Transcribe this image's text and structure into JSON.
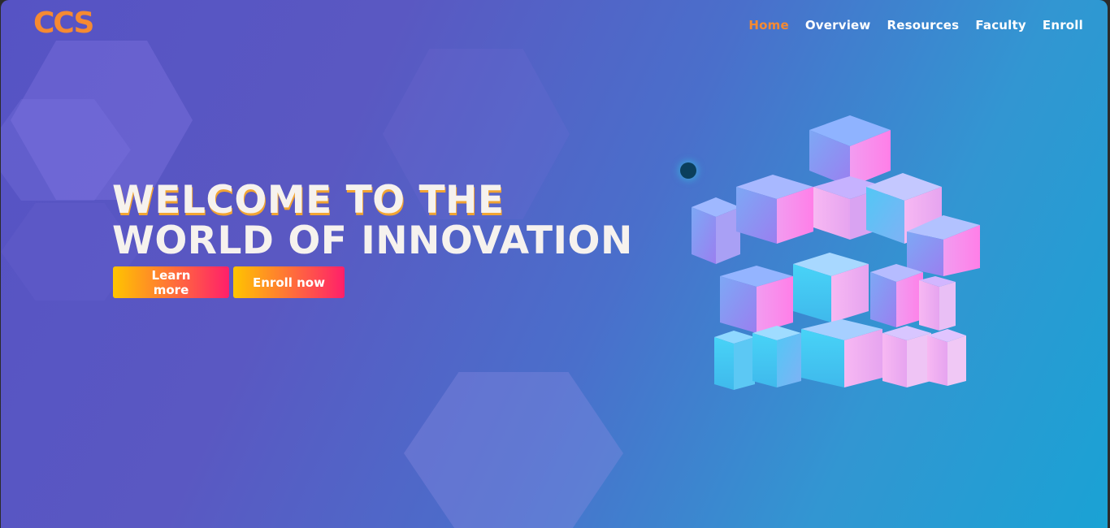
{
  "brand": {
    "logo_text": "CCS",
    "accent_color": "#f58a32"
  },
  "nav": {
    "items": [
      {
        "label": "Home",
        "active": true
      },
      {
        "label": "Overview",
        "active": false
      },
      {
        "label": "Resources",
        "active": false
      },
      {
        "label": "Faculty",
        "active": false
      },
      {
        "label": "Enroll",
        "active": false
      }
    ]
  },
  "hero": {
    "title_line1": "WELCOME TO THE",
    "title_line2": "WORLD OF INNOVATION",
    "buttons": {
      "learn_more": "Learn more",
      "enroll_now": "Enroll now"
    },
    "illustration": "cube-cluster-icon"
  },
  "colors": {
    "background_start": "#5653c4",
    "background_end": "#1aa2d4",
    "title_color": "#f6f2ee",
    "button_gradient_start": "#ffc400",
    "button_gradient_end": "#ff1f6a"
  }
}
